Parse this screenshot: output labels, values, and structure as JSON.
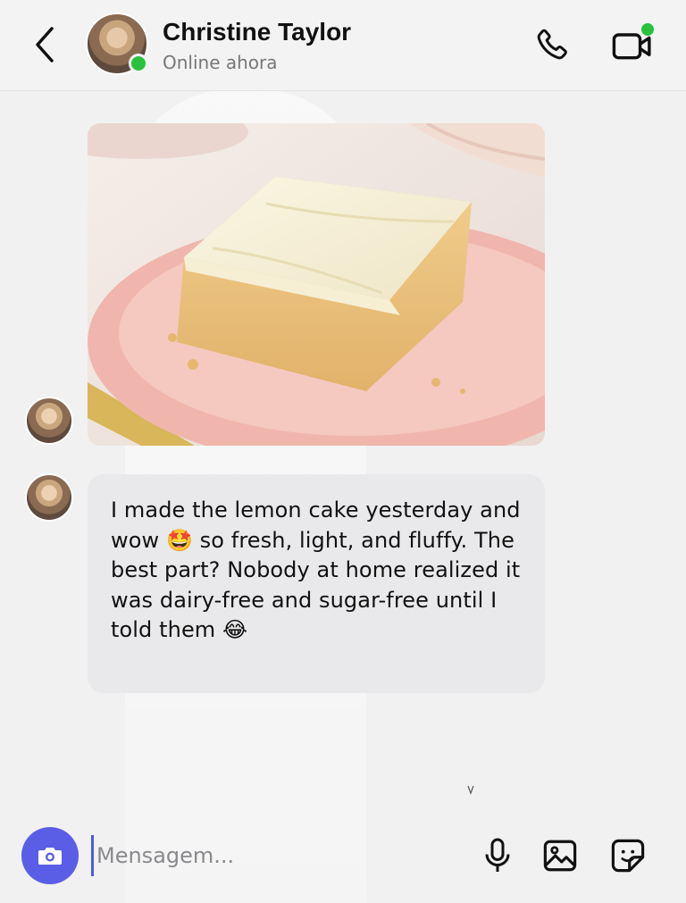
{
  "header": {
    "back_icon": "chevron-left-icon",
    "contact_name": "Christine Taylor",
    "status": "Online ahora",
    "call_icon": "phone-icon",
    "video_icon": "video-camera-icon"
  },
  "messages": [
    {
      "type": "image",
      "description_icon": "cake-photo"
    },
    {
      "type": "text",
      "text": "I made the lemon cake yesterday and wow 🤩 so fresh, light, and fluffy. The best part? Nobody at home realized it was dairy-free and sugar-free until I told them 😂"
    }
  ],
  "scroll_hint": "^",
  "composer": {
    "camera_icon": "camera-icon",
    "placeholder": "Mensagem...",
    "value": "",
    "mic_icon": "microphone-icon",
    "gallery_icon": "image-icon",
    "sticker_icon": "sticker-icon"
  },
  "colors": {
    "accent": "#5a5ee6",
    "online": "#29c23c",
    "bubble": "#e9e9eb",
    "background": "#f1f1f2"
  }
}
